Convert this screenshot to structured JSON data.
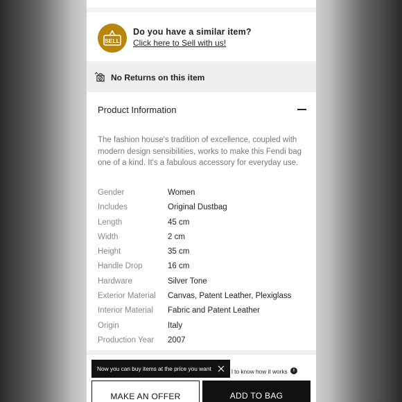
{
  "sell_prompt": {
    "badge_text": "SELL",
    "badge_color": "#b8860b",
    "question": "Do you have a similar item?",
    "link": "Click here to Sell with us!"
  },
  "returns": {
    "icon": "no-returns-icon",
    "text": "No Returns on this item"
  },
  "product_info": {
    "title": "Product Information",
    "description": "The fashion house's tradition of excellence, coupled with modern design sensibilities, works to make this Fendi bag one of a kind. It's a fabulous accessory for everyday use.",
    "attributes": [
      {
        "key": "Gender",
        "value": "Women"
      },
      {
        "key": "Includes",
        "value": "Original Dustbag"
      },
      {
        "key": "Length",
        "value": "45 cm"
      },
      {
        "key": "Width",
        "value": "2 cm"
      },
      {
        "key": "Height",
        "value": "35 cm"
      },
      {
        "key": "Handle Drop",
        "value": "16 cm"
      },
      {
        "key": "Hardware",
        "value": "Silver Tone"
      },
      {
        "key": "Exterior Material",
        "value": "Canvas, Patent Leather, Plexiglass"
      },
      {
        "key": "Interior Material",
        "value": "Fabric and Patent Leather"
      },
      {
        "key": "Origin",
        "value": "Italy"
      },
      {
        "key": "Production Year",
        "value": "2007"
      }
    ]
  },
  "offer_bar": {
    "tooltip": "Now you can buy items at the price you want",
    "how_it_works": "l to know how it works",
    "info_glyph": "i",
    "make_offer": "MAKE AN OFFER",
    "add_to_bag": "ADD TO BAG"
  }
}
